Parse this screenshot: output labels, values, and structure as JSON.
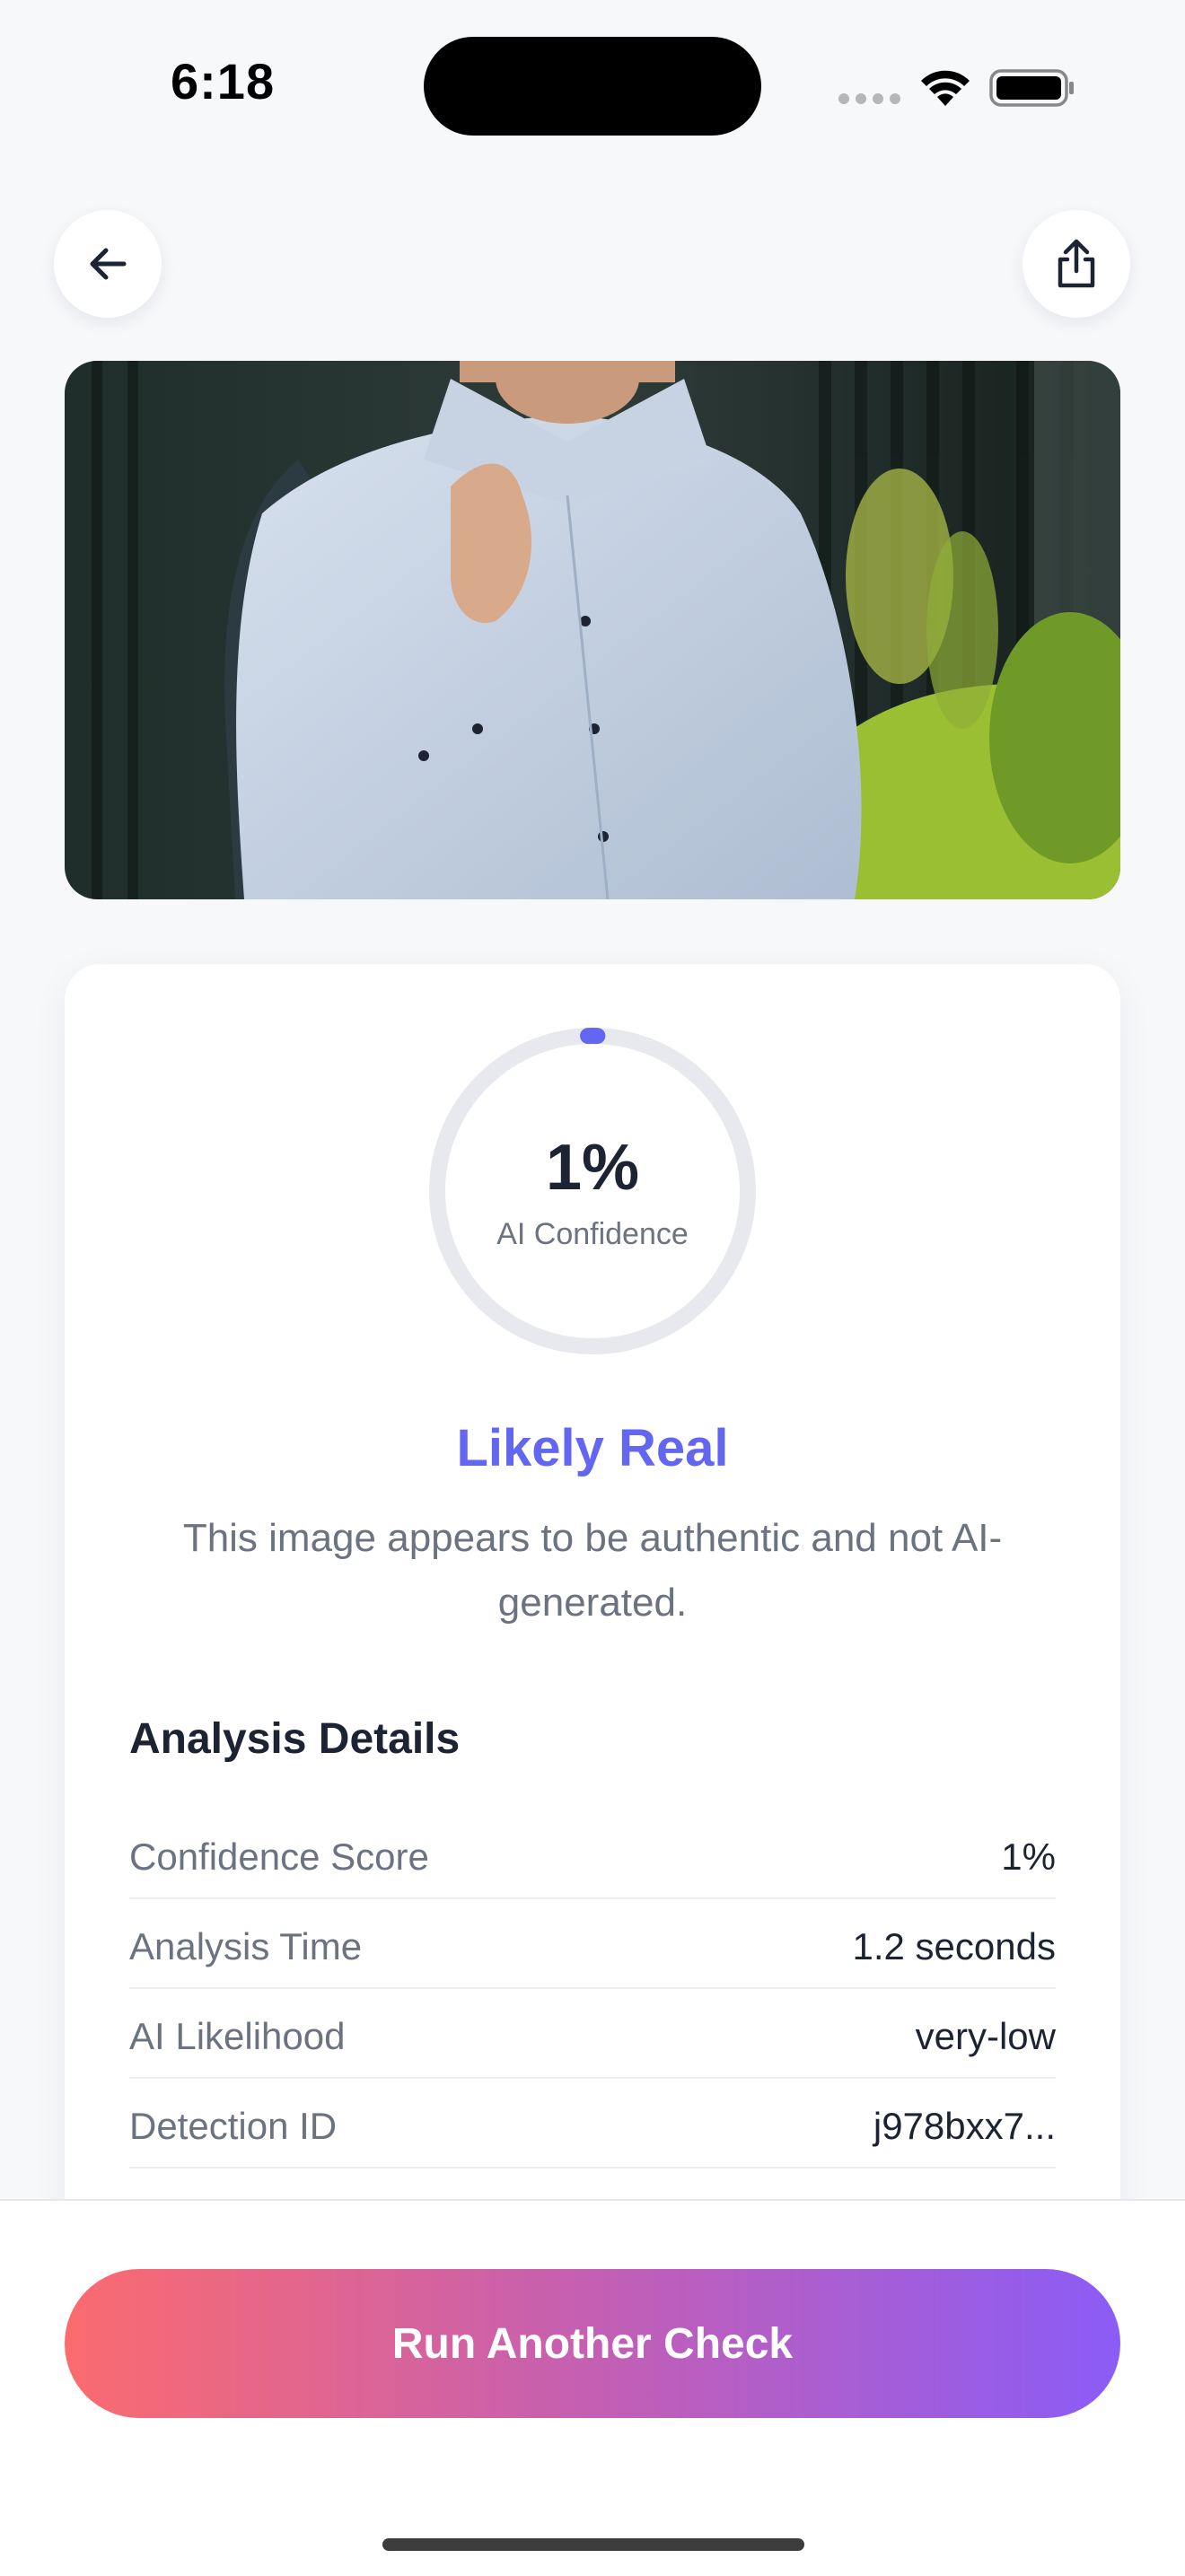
{
  "status_bar": {
    "time": "6:18"
  },
  "nav": {
    "back_icon": "arrow-left-icon",
    "share_icon": "share-icon"
  },
  "photo": {
    "subject": "man in light blue shirt holding jacket over shoulder"
  },
  "result": {
    "confidence_value": "1%",
    "confidence_fraction": 0.01,
    "confidence_label": "AI Confidence",
    "verdict": "Likely Real",
    "description": "This image appears to be authentic and not AI-generated."
  },
  "details": {
    "title": "Analysis Details",
    "rows": [
      {
        "label": "Confidence Score",
        "value": "1%"
      },
      {
        "label": "Analysis Time",
        "value": "1.2 seconds"
      },
      {
        "label": "AI Likelihood",
        "value": "very-low"
      },
      {
        "label": "Detection ID",
        "value": "j978bxx7..."
      }
    ]
  },
  "cta": {
    "label": "Run Another Check"
  },
  "colors": {
    "accent": "#6366f1",
    "gradient_start": "#fb6b6f",
    "gradient_end": "#8b5cf6",
    "gauge_track": "#e8e9ee"
  }
}
